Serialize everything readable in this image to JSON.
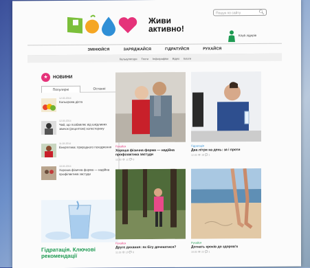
{
  "header": {
    "logo_text": "Живи активно!",
    "search_placeholder": "Пошук по сайту",
    "club_label": "Клуб лідерів"
  },
  "main_nav": [
    "ЗМІНЮЙСЯ",
    "ЗАРЯДЖАЙСЯ",
    "ГІДРАТУЙСЯ",
    "РУХАЙСЯ"
  ],
  "sub_nav": [
    "Калькулятори",
    "Тести",
    "Інфографіки",
    "Відео",
    "Блоги"
  ],
  "sidebar": {
    "title": "НОВИНИ",
    "tabs": [
      "Популярні",
      "Останні"
    ],
    "news": [
      {
        "date": "12.03.2014",
        "text": "Кольорова дієта"
      },
      {
        "date": "12.03.2014",
        "text": "Чай, що позбавляє від шкідливих звичок (рецептом) холестерину"
      },
      {
        "date": "11.03.2014",
        "text": "Енергетика: природного походження"
      },
      {
        "date": "10.03.2014",
        "text": "Хороша фізична форма — надійна профілактика застуди"
      }
    ],
    "promo_caption": "Гідратація. Ключові рекомендації"
  },
  "articles": [
    {
      "category": "Рухайся",
      "title": "Хороша фізична форма — надійна профілактика застуди",
      "meta": "12.03  👁 12  💬 0"
    },
    {
      "category": "Гідратація",
      "title": "Два літри на день: за і проти",
      "meta": "12.03  👁 18  💬 1"
    },
    {
      "category": "Рухайся",
      "title": "Друге дихання: як бігу дочекатися?",
      "meta": "11.03  👁 15  💬 0"
    },
    {
      "category": "Рухайся",
      "title": "Догнать кроків до здоров'я",
      "meta": "10.03  👁 22  💬 1"
    }
  ],
  "colors": {
    "accent": "#e5337a",
    "green": "#1e9a52",
    "blue": "#2f8fd6"
  }
}
